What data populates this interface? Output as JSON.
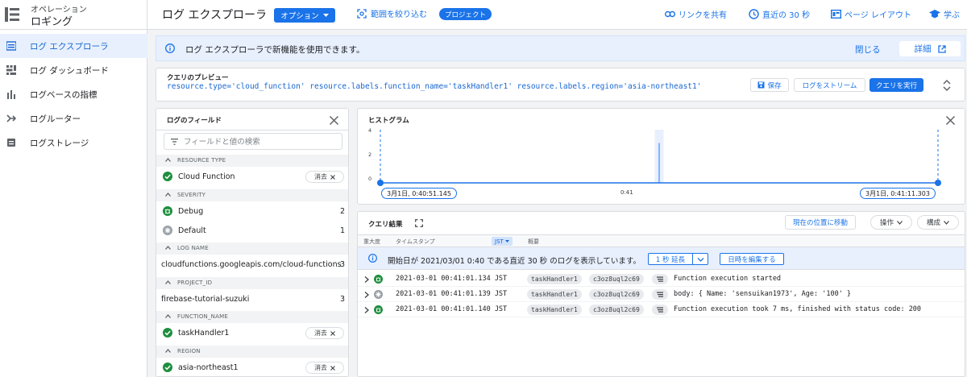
{
  "app": {
    "category": "オペレーション",
    "name": "ロギング"
  },
  "sidebar": {
    "items": [
      {
        "label": "ログ エクスプローラ",
        "icon": "log-explorer-icon",
        "active": true
      },
      {
        "label": "ログ ダッシュボード",
        "icon": "dashboard-icon",
        "active": false
      },
      {
        "label": "ログベースの指標",
        "icon": "bar-chart-icon",
        "active": false
      },
      {
        "label": "ログルーター",
        "icon": "router-icon",
        "active": false
      },
      {
        "label": "ログストレージ",
        "icon": "storage-icon",
        "active": false
      }
    ]
  },
  "header": {
    "title": "ログ エクスプローラ",
    "options_label": "オプション",
    "narrow_scope_label": "範囲を絞り込む",
    "project_chip": "プロジェクト",
    "share_link_label": "リンクを共有",
    "recent_label": "直近の 30 秒",
    "page_layout_label": "ページ レイアウト",
    "learn_label": "学ぶ"
  },
  "banner": {
    "message": "ログ エクスプローラで新機能を使用できます。",
    "close_label": "閉じる",
    "detail_label": "詳細"
  },
  "query": {
    "title": "クエリのプレビュー",
    "text": "resource.type='cloud_function' resource.labels.function_name='taskHandler1' resource.labels.region='asia-northeast1'",
    "save_label": "保存",
    "stream_label": "ログをストリーム",
    "run_label": "クエリを実行"
  },
  "fields": {
    "title": "ログのフィールド",
    "search_placeholder": "フィールドと値の検索",
    "sections": [
      {
        "label": "RESOURCE TYPE",
        "rows": [
          {
            "label": "Cloud Function",
            "clear": "消去",
            "icon": "check-circle-icon"
          }
        ]
      },
      {
        "label": "SEVERITY",
        "rows": [
          {
            "label": "Debug",
            "count": "2",
            "icon": "debug-icon"
          },
          {
            "label": "Default",
            "count": "1",
            "icon": "default-severity-icon"
          }
        ]
      },
      {
        "label": "LOG NAME",
        "rows": [
          {
            "label": "cloudfunctions.googleapis.com/cloud-functions",
            "count": "3"
          }
        ]
      },
      {
        "label": "PROJECT_ID",
        "rows": [
          {
            "label": "firebase-tutorial-suzuki",
            "count": "3"
          }
        ]
      },
      {
        "label": "FUNCTION_NAME",
        "rows": [
          {
            "label": "taskHandler1",
            "clear": "消去",
            "icon": "check-circle-icon"
          }
        ]
      },
      {
        "label": "REGION",
        "rows": [
          {
            "label": "asia-northeast1",
            "clear": "消去",
            "icon": "check-circle-icon"
          }
        ]
      }
    ]
  },
  "histogram": {
    "title": "ヒストグラム",
    "y_ticks": [
      "4",
      "2",
      "0"
    ],
    "start_label": "3月1日, 0:40:51.145",
    "mid_label": "0:41",
    "end_label": "3月1日, 0:41:11.303",
    "bar_value": 3,
    "y_max": 4,
    "bar_position_fraction": 0.5
  },
  "results": {
    "title": "クエリ結果",
    "jump_label": "現在の位置に移動",
    "actions_label": "操作",
    "config_label": "構成",
    "columns": {
      "severity": "重大度",
      "timestamp": "タイムスタンプ",
      "tz": "JST",
      "summary": "概要"
    },
    "info_message": "開始日が 2021/03/01 0:40 である直近 30 秒 のログを表示しています。",
    "extend_label": "1 秒 延長",
    "edit_time_label": "日時を編集する",
    "rows": [
      {
        "severity": "debug",
        "timestamp": "2021-03-01 00:41:01.134 JST",
        "chip1": "taskHandler1",
        "chip2": "c3oz8uql2c69",
        "summary": "Function execution started"
      },
      {
        "severity": "default",
        "timestamp": "2021-03-01 00:41:01.139 JST",
        "chip1": "taskHandler1",
        "chip2": "c3oz8uql2c69",
        "summary": "body: { Name: 'sensuikan1973', Age: '100' }"
      },
      {
        "severity": "debug",
        "timestamp": "2021-03-01 00:41:01.140 JST",
        "chip1": "taskHandler1",
        "chip2": "c3oz8uql2c69",
        "summary": "Function execution took 7 ms, finished with status code: 200"
      }
    ]
  },
  "colors": {
    "accent": "#1a73e8",
    "success": "#1e8e3e",
    "default_severity": "#9aa0a6"
  }
}
